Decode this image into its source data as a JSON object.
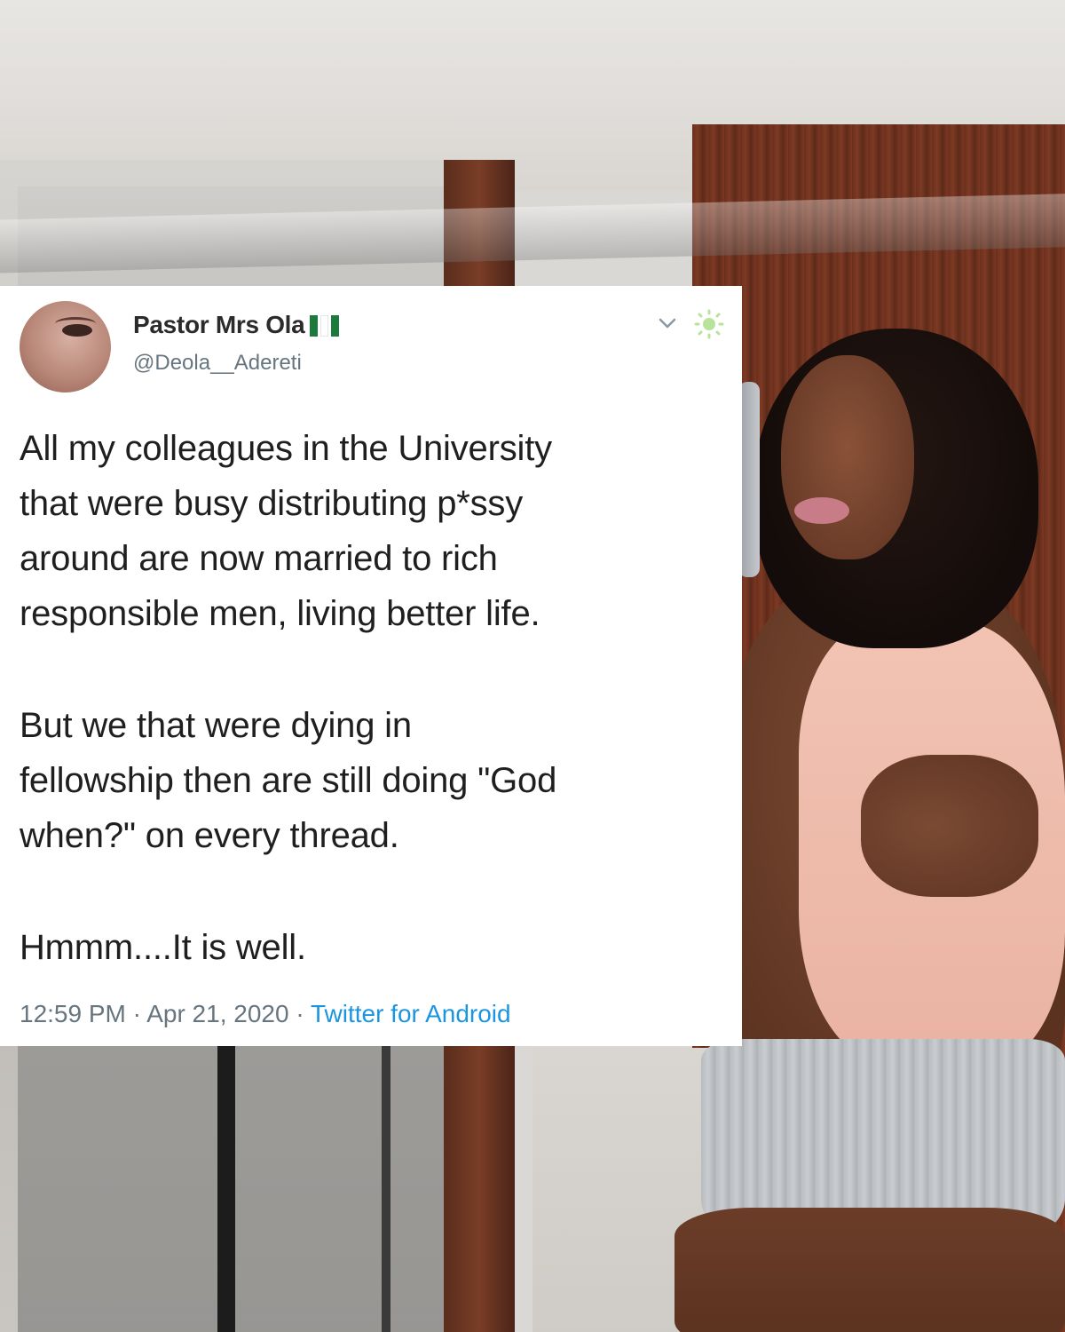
{
  "tweet": {
    "display_name": "Pastor Mrs Ola",
    "handle": "@Deola__Adereti",
    "body": {
      "paragraph1": [
        "All my colleagues in the University",
        "that were busy distributing p*ssy",
        "around are now married to rich",
        "responsible men, living better life."
      ],
      "paragraph2": [
        "But we that were dying in",
        "fellowship then are still doing \"God",
        "when?\" on every thread."
      ],
      "paragraph3": [
        "Hmmm....It is well."
      ]
    },
    "time": "12:59 PM",
    "date": "Apr 21, 2020",
    "separator": "·",
    "source": "Twitter for Android",
    "icons": [
      "nigeria-flag-icon",
      "chevron-down-icon",
      "sun-icon"
    ]
  },
  "colors": {
    "card_bg": "#ffffff",
    "text": "#1f1f1f",
    "muted": "#67757f",
    "link": "#1b95e0",
    "flag_green": "#1b7a3c"
  }
}
